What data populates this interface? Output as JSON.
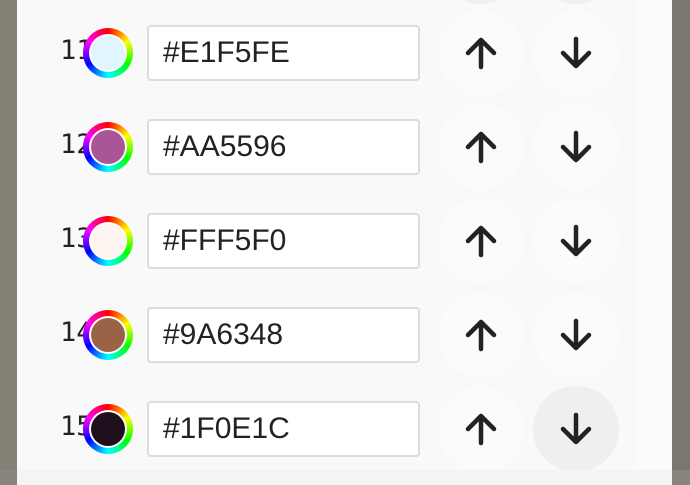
{
  "palette": {
    "rows": [
      {
        "index": "11",
        "hex": "#E1F5FE",
        "swatch_color": "#E1F5FE",
        "up_icon": "arrow-up-icon",
        "down_icon": "arrow-down-icon",
        "down_active": false
      },
      {
        "index": "12",
        "hex": "#AA5596",
        "swatch_color": "#AA5596",
        "up_icon": "arrow-up-icon",
        "down_icon": "arrow-down-icon",
        "down_active": false
      },
      {
        "index": "13",
        "hex": "#FFF5F0",
        "swatch_color": "#FFF5F0",
        "up_icon": "arrow-up-icon",
        "down_icon": "arrow-down-icon",
        "down_active": false
      },
      {
        "index": "14",
        "hex": "#9A6348",
        "swatch_color": "#9A6348",
        "up_icon": "arrow-up-icon",
        "down_icon": "arrow-down-icon",
        "down_active": false
      },
      {
        "index": "15",
        "hex": "#1F0E1C",
        "swatch_color": "#1F0E1C",
        "up_icon": "arrow-up-icon",
        "down_icon": "arrow-down-icon",
        "down_active": true
      }
    ]
  },
  "colors": {
    "icon": "#222222",
    "field_border": "#DCDCDC",
    "panel": "#F9F9F9",
    "backdrop": "#7F7B72"
  }
}
